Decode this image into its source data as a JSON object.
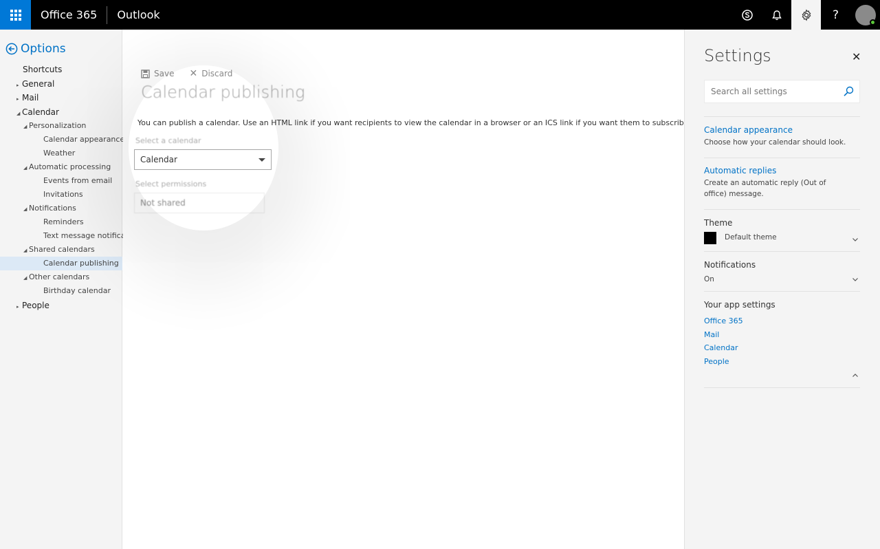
{
  "topbar": {
    "brand": "Office 365",
    "app": "Outlook"
  },
  "nav": {
    "title": "Options",
    "items": [
      {
        "label": "Shortcuts",
        "level": 0,
        "expander": ""
      },
      {
        "label": "General",
        "level": 0,
        "expander": "▸"
      },
      {
        "label": "Mail",
        "level": 0,
        "expander": "▸"
      },
      {
        "label": "Calendar",
        "level": 0,
        "expander": "◢"
      },
      {
        "label": "Personalization",
        "level": 1,
        "expander": "◢"
      },
      {
        "label": "Calendar appearance",
        "level": 2,
        "expander": ""
      },
      {
        "label": "Weather",
        "level": 2,
        "expander": ""
      },
      {
        "label": "Automatic processing",
        "level": 1,
        "expander": "◢"
      },
      {
        "label": "Events from email",
        "level": 2,
        "expander": ""
      },
      {
        "label": "Invitations",
        "level": 2,
        "expander": ""
      },
      {
        "label": "Notifications",
        "level": 1,
        "expander": "◢"
      },
      {
        "label": "Reminders",
        "level": 2,
        "expander": ""
      },
      {
        "label": "Text message notifications",
        "level": 2,
        "expander": ""
      },
      {
        "label": "Shared calendars",
        "level": 1,
        "expander": "◢"
      },
      {
        "label": "Calendar publishing",
        "level": 2,
        "expander": "",
        "selected": true
      },
      {
        "label": "Other calendars",
        "level": 1,
        "expander": "◢"
      },
      {
        "label": "Birthday calendar",
        "level": 2,
        "expander": ""
      },
      {
        "label": "People",
        "level": 0,
        "expander": "▸"
      }
    ]
  },
  "main": {
    "save_label": "Save",
    "discard_label": "Discard",
    "title": "Calendar publishing",
    "description": "You can publish a calendar. Use an HTML link if you want recipients to view the calendar in a browser or an ICS link if you want them to subscribe.",
    "select_calendar_label": "Select a calendar",
    "select_calendar_value": "Calendar",
    "select_permissions_label": "Select permissions",
    "select_permissions_value": "Not shared"
  },
  "settings": {
    "title": "Settings",
    "search_placeholder": "Search all settings",
    "calendar_appearance": {
      "title": "Calendar appearance",
      "desc": "Choose how your calendar should look."
    },
    "automatic_replies": {
      "title": "Automatic replies",
      "desc": "Create an automatic reply (Out of office) message."
    },
    "theme": {
      "head": "Theme",
      "value": "Default theme"
    },
    "notifications": {
      "head": "Notifications",
      "value": "On"
    },
    "app_settings": {
      "head": "Your app settings",
      "links": [
        "Office 365",
        "Mail",
        "Calendar",
        "People"
      ]
    }
  },
  "colors": {
    "accent": "#0072c6",
    "waffle": "#0078d7",
    "topbar": "#000000",
    "presence": "#5cc83a"
  }
}
